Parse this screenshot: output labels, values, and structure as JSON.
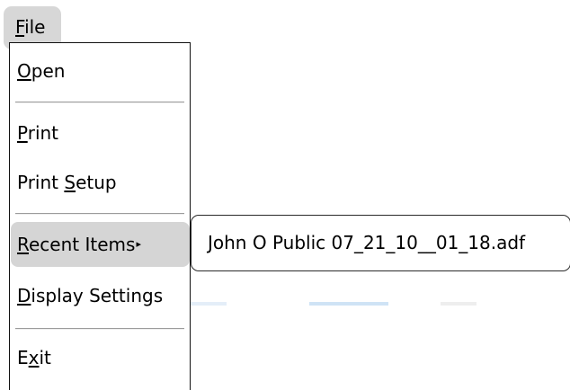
{
  "menubar": {
    "file_label_first": "F",
    "file_label_rest": "ile"
  },
  "file_menu": {
    "open": {
      "accel": "O",
      "rest": "pen"
    },
    "print": {
      "accel": "P",
      "rest": "rint"
    },
    "print_setup": {
      "before": "Print ",
      "accel": "S",
      "rest": "etup"
    },
    "recent_items": {
      "accel": "R",
      "rest": "ecent Items",
      "arrow": "▸"
    },
    "display_settings": {
      "accel": "D",
      "rest": "isplay Settings"
    },
    "exit": {
      "before": "E",
      "accel": "x",
      "rest": "it"
    }
  },
  "recent_submenu": {
    "items": [
      "John O Public 07_21_10__01_18.adf"
    ]
  },
  "colors": {
    "highlight": "#d5d5d5",
    "menubar_active": "#d7d7d7",
    "background_strip_blue": "#cfe3f5"
  }
}
